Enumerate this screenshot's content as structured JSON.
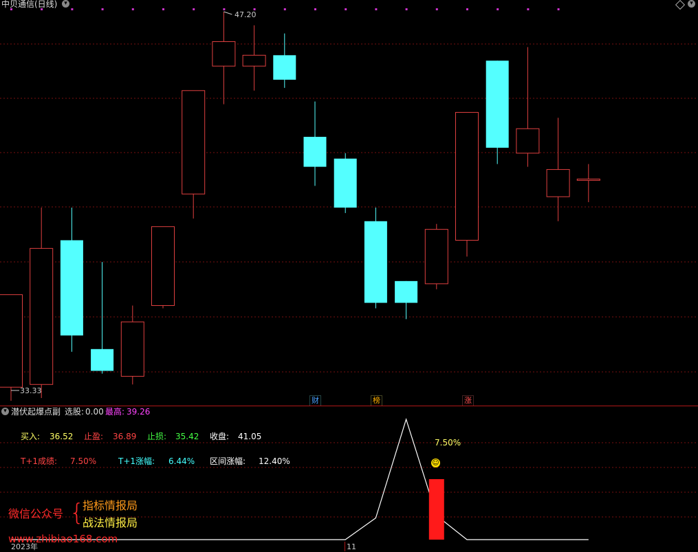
{
  "header": {
    "title": "中贝通信(日线)"
  },
  "main_chart": {
    "price_high_label": "47.20",
    "price_low_label": "33.33",
    "markers": [
      {
        "text": "财",
        "color": "#4aa0ff"
      },
      {
        "text": "榜",
        "color": "#ffb000"
      },
      {
        "text": "涨",
        "color": "#ff5050"
      }
    ]
  },
  "indicator": {
    "name": "潜伏起爆点副",
    "pick_label": "选股:",
    "pick_value": "0.00",
    "high_label": "最高:",
    "high_value": "39.26",
    "buy_label": "买入:",
    "buy_value": "36.52",
    "take_profit_label": "止盈:",
    "take_profit_value": "36.89",
    "stop_loss_label": "止损:",
    "stop_loss_value": "35.42",
    "close_label": "收盘:",
    "close_value": "41.05",
    "t1_result_label": "T+1成绩:",
    "t1_result_value": "7.50%",
    "t1_rise_label": "T+1涨幅:",
    "t1_rise_value": "6.44%",
    "range_rise_label": "区间涨幅:",
    "range_rise_value": "12.40%",
    "bar_annotation": "7.50%"
  },
  "watermark": {
    "left": "微信公众号",
    "line1": "指标情报局",
    "line2": "战法情报局",
    "url": "www.zhibiao168.com"
  },
  "time_axis": {
    "year_label": "2023年",
    "month_label": "11"
  },
  "colors": {
    "up": "#e04040",
    "down": "#54ffff",
    "grid": "#7a1010",
    "buy": "#ffff66",
    "take_profit": "#ff4444",
    "stop_loss": "#44ff44",
    "high": "#ff44ff"
  },
  "chart_data": {
    "type": "candlestick",
    "ylim": [
      33.0,
      48.0
    ],
    "candles": [
      {
        "open": 33.4,
        "close": 36.8,
        "high": 36.8,
        "low": 32.9
      },
      {
        "open": 33.5,
        "close": 38.5,
        "high": 40.0,
        "low": 33.0
      },
      {
        "open": 38.8,
        "close": 35.3,
        "high": 40.0,
        "low": 34.7
      },
      {
        "open": 34.8,
        "close": 34.0,
        "high": 38.0,
        "low": 33.9
      },
      {
        "open": 33.8,
        "close": 35.8,
        "high": 36.4,
        "low": 33.5
      },
      {
        "open": 36.4,
        "close": 39.3,
        "high": 39.3,
        "low": 36.3
      },
      {
        "open": 40.5,
        "close": 44.3,
        "high": 44.3,
        "low": 39.6
      },
      {
        "open": 45.2,
        "close": 46.1,
        "high": 47.2,
        "low": 43.8
      },
      {
        "open": 45.2,
        "close": 45.6,
        "high": 46.7,
        "low": 44.3
      },
      {
        "open": 45.6,
        "close": 44.7,
        "high": 46.4,
        "low": 44.4
      },
      {
        "open": 42.6,
        "close": 41.5,
        "high": 43.9,
        "low": 40.8
      },
      {
        "open": 41.8,
        "close": 40.0,
        "high": 42.0,
        "low": 39.8
      },
      {
        "open": 39.5,
        "close": 36.5,
        "high": 40.0,
        "low": 36.3
      },
      {
        "open": 37.3,
        "close": 36.5,
        "high": 37.3,
        "low": 35.9
      },
      {
        "open": 37.2,
        "close": 39.2,
        "high": 39.4,
        "low": 37.0
      },
      {
        "open": 38.8,
        "close": 43.5,
        "high": 43.5,
        "low": 38.2
      },
      {
        "open": 45.4,
        "close": 42.2,
        "high": 45.4,
        "low": 41.6
      },
      {
        "open": 42.0,
        "close": 42.9,
        "high": 45.9,
        "low": 41.5
      },
      {
        "open": 40.4,
        "close": 41.4,
        "high": 43.3,
        "low": 39.5
      },
      {
        "open": 41.0,
        "close": 41.05,
        "high": 41.6,
        "low": 40.2
      }
    ],
    "indicator_line": [
      0,
      0,
      0,
      0,
      0,
      0,
      0,
      0,
      0,
      0,
      0,
      0,
      0.18,
      1.0,
      0.2,
      0,
      0,
      0,
      0,
      0
    ],
    "indicator_bar": {
      "index": 14,
      "value": 7.5
    }
  }
}
